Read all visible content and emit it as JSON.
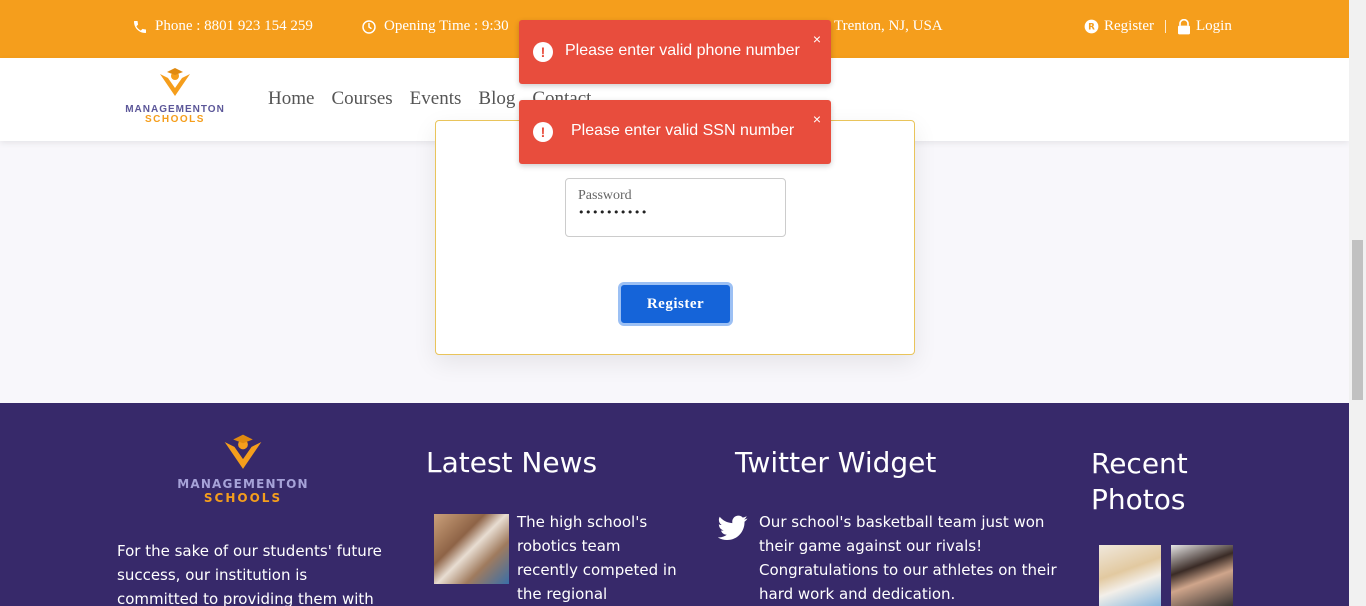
{
  "topbar": {
    "phone": "Phone :  8801 923 154 259",
    "opening": "Opening Time :  9:30",
    "address": "Trenton, NJ, USA",
    "register": "Register",
    "separator": "|",
    "login": "Login"
  },
  "header": {
    "logo_line1": "MANAGEMENTON",
    "logo_line2": "SCHOOLS",
    "nav": [
      "Home",
      "Courses",
      "Events",
      "Blog",
      "Contact"
    ]
  },
  "form": {
    "password_label": "Password",
    "password_value": "••••••••••",
    "register_button": "Register"
  },
  "toasts": [
    {
      "message": "Please enter valid phone number",
      "close": "×"
    },
    {
      "message": "Please enter valid SSN number",
      "close": "×"
    }
  ],
  "footer": {
    "logo_line1": "MANAGEMENTON",
    "logo_line2": "SCHOOLS",
    "about": "For the sake of our students' future success, our institution is committed to providing them with an education",
    "news_heading": "Latest News",
    "news_text": "The high school's robotics team recently competed in the regional",
    "twitter_heading": "Twitter Widget",
    "twitter_text": "Our school's basketball team just won their game against our rivals! Congratulations to our athletes on their hard work and dedication.",
    "photos_heading_1": "Recent",
    "photos_heading_2": "Photos"
  },
  "colors": {
    "topbar": "#f59e1c",
    "footer": "#37296a",
    "toast": "#e84d3d",
    "button": "#1564d9"
  }
}
